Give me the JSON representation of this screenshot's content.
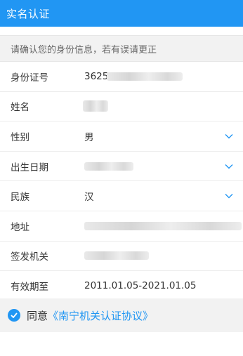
{
  "header": {
    "title": "实名认证"
  },
  "notice": "请确认您的身份信息，若有误请更正",
  "fields": [
    {
      "label": "身份证号",
      "value": "36252"
    },
    {
      "label": "姓名",
      "value": ""
    },
    {
      "label": "性别",
      "value": "男",
      "has_dropdown": true
    },
    {
      "label": "出生日期",
      "value": "",
      "has_dropdown": true
    },
    {
      "label": "民族",
      "value": "汉",
      "has_dropdown": true
    },
    {
      "label": "地址",
      "value": ""
    },
    {
      "label": "签发机关",
      "value": ""
    },
    {
      "label": "有效期至",
      "value": "2011.01.05-2021.01.05"
    }
  ],
  "agreement": {
    "prefix": "同意",
    "link": "《南宁机关认证协议》",
    "checked": true
  },
  "colors": {
    "accent": "#2196f3"
  },
  "icons": {
    "dropdown": "chevron-down-icon",
    "checkbox": "checkmark-icon"
  }
}
